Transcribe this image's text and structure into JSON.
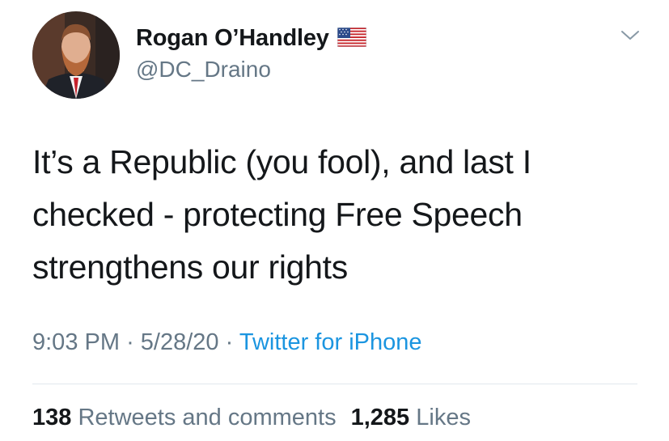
{
  "author": {
    "display_name": "Rogan O’Handley",
    "handle": "@DC_Draino",
    "badge_icon": "us-flag-icon",
    "avatar_icon": "profile-photo"
  },
  "menu_icon": "chevron-down-icon",
  "tweet": {
    "lines": [
      "It’s a Republic (you fool), and last I",
      "checked - protecting Free Speech",
      "strengthens our rights"
    ]
  },
  "meta": {
    "time": "9:03 PM",
    "separator": "·",
    "date": "5/28/20",
    "source": "Twitter for iPhone"
  },
  "stats": {
    "retweets_count": "138",
    "retweets_label": "Retweets and comments",
    "likes_count": "1,285",
    "likes_label": "Likes"
  },
  "colors": {
    "text_primary": "#14171a",
    "text_secondary": "#657786",
    "link": "#1b95e0",
    "divider": "#e1e8ed"
  }
}
